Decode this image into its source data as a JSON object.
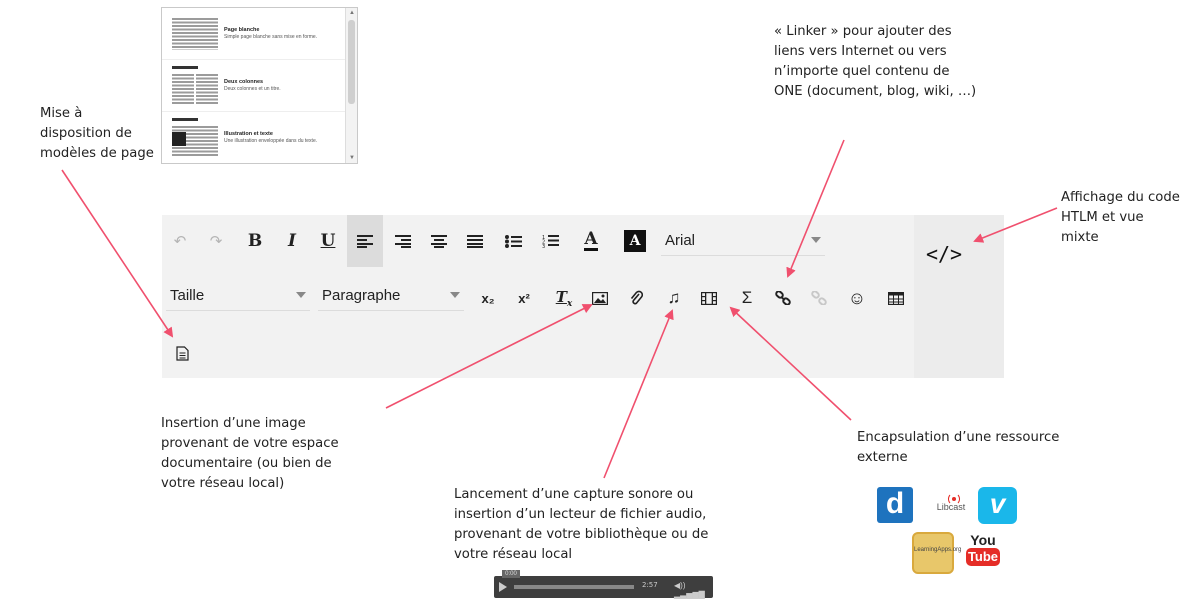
{
  "annotations": {
    "templates": "Mise à\ndisposition de\nmodèles de page",
    "linker": "« Linker » pour ajouter des\nliens vers Internet ou vers\nn’importe quel contenu de\nONE (document, blog, wiki, …)",
    "code_view": "Affichage du code\nHTLM et vue\nmixte",
    "image": "Insertion d’une image\nprovenant de votre espace\ndocumentaire (ou bien de\nvotre réseau local)",
    "audio": "Lancement d’une capture sonore ou\ninsertion d’un lecteur de fichier audio,\nprovenant de votre bibliothèque ou de\nvotre réseau local",
    "embed": "Encapsulation d’une ressource\nexterne"
  },
  "templates": [
    {
      "title": "Page blanche",
      "desc": "Simple page blanche sans mise en forme."
    },
    {
      "title": "Deux colonnes",
      "desc": "Deux colonnes et un titre."
    },
    {
      "title": "Illustration et texte",
      "desc": "Une illustration enveloppée dans du texte."
    }
  ],
  "toolbar": {
    "undo": "↶",
    "redo": "↷",
    "bold": "B",
    "italic": "I",
    "underline": "U",
    "text_color": "A",
    "bg_color": "A",
    "font": "Arial",
    "size": "Taille",
    "format": "Paragraphe",
    "subscript": "x₂",
    "superscript": "x²",
    "clear_format": "T",
    "code": "</>",
    "music": "♫",
    "sigma": "Σ",
    "smiley": "☺"
  },
  "player": {
    "time": "2:57",
    "tip": "0:00"
  },
  "logos": {
    "dailymotion": "d",
    "libcast": "Libcast",
    "vimeo": "v",
    "learningapps": "LearningApps.org",
    "youtube_top": "You",
    "youtube_bottom": "Tube"
  },
  "colors": {
    "arrow": "#f0506e",
    "accent_blue": "#1e73be",
    "vimeo": "#1ab7ea",
    "youtube": "#e52d27"
  }
}
